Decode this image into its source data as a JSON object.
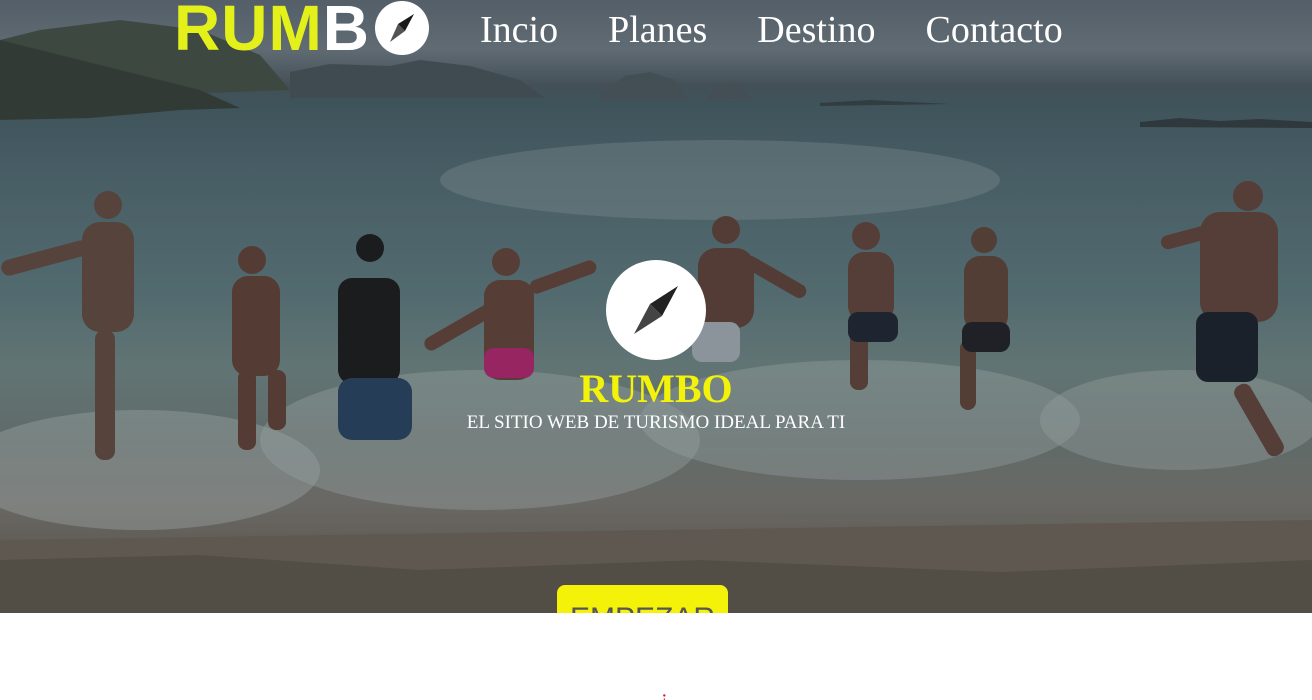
{
  "header": {
    "logo": {
      "part1": "RUM",
      "part2": "B",
      "icon": "compass-icon"
    },
    "nav": [
      {
        "label": "Incio"
      },
      {
        "label": "Planes"
      },
      {
        "label": "Destino"
      },
      {
        "label": "Contacto"
      }
    ]
  },
  "hero": {
    "background": "beach-photo-people-running-into-sea",
    "icon": "compass-icon",
    "title": "RUMBO",
    "subtitle": "EL SITIO WEB DE TURISMO IDEAL PARA TI",
    "cta_label": "EMPEZAR"
  },
  "below": {
    "partial_glyph": "¡"
  },
  "colors": {
    "accent_yellow": "#f2f20b",
    "logo_yellow": "#e3f01a",
    "button_yellow": "#f5f20a",
    "nav_text": "#ffffff"
  }
}
